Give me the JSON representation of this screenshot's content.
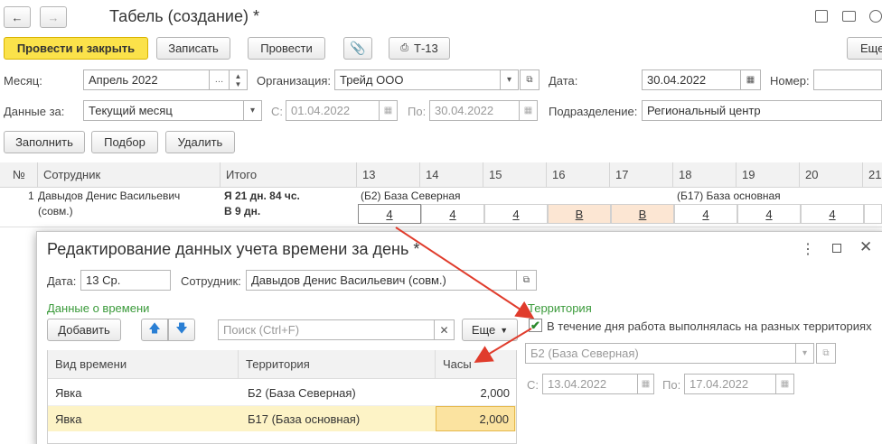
{
  "header": {
    "back_icon": "arrow-left-icon",
    "forward_icon": "arrow-right-icon",
    "title": "Табель (создание) *"
  },
  "toolbar": {
    "post_close": "Провести и закрыть",
    "save": "Записать",
    "post": "Провести",
    "t13": "Т-13",
    "more": "Еще"
  },
  "form": {
    "month_label": "Месяц:",
    "month_value": "Апрель 2022",
    "org_label": "Организация:",
    "org_value": "Трейд ООО",
    "date_label": "Дата:",
    "date_value": "30.04.2022",
    "number_label": "Номер:",
    "data_label": "Данные за:",
    "data_value": "Текущий месяц",
    "from_label": "С:",
    "from_value": "01.04.2022",
    "to_label": "По:",
    "to_value": "30.04.2022",
    "dept_label": "Подразделение:",
    "dept_value": "Региональный центр"
  },
  "actions": {
    "fill": "Заполнить",
    "select": "Подбор",
    "delete": "Удалить"
  },
  "grid": {
    "col_num": "№",
    "col_emp": "Сотрудник",
    "col_total": "Итого",
    "days": [
      "13",
      "14",
      "15",
      "16",
      "17",
      "18",
      "19",
      "20",
      "21"
    ],
    "row": {
      "num": "1",
      "employee_line1": "Давыдов Денис Васильевич",
      "employee_line2": "(совм.)",
      "total_line1": "Я 21 дн. 84 чс.",
      "total_line2": "В 9 дн.",
      "terr1": "(Б2) База Северная",
      "terr2": "(Б17) База основная",
      "values": [
        "4",
        "4",
        "4",
        "В",
        "В",
        "4",
        "4",
        "4"
      ]
    }
  },
  "dialog": {
    "title": "Редактирование данных учета времени за день *",
    "date_label": "Дата:",
    "date_value": "13 Ср.",
    "emp_label": "Сотрудник:",
    "emp_value": "Давыдов Денис Васильевич (совм.)",
    "section_time": "Данные о времени",
    "add": "Добавить",
    "search_placeholder": "Поиск (Ctrl+F)",
    "more": "Еще",
    "col_kind": "Вид времени",
    "col_terr": "Территория",
    "col_hours": "Часы",
    "rows": [
      {
        "kind": "Явка",
        "terr": "Б2 (База Северная)",
        "hours": "2,000"
      },
      {
        "kind": "Явка",
        "terr": "Б17 (База основная)",
        "hours": "2,000"
      }
    ],
    "section_terr": "Территория",
    "checkbox_label": "В течение дня работа выполнялась на разных территориях",
    "terr_value": "Б2 (База Северная)",
    "from_label": "С:",
    "from_value": "13.04.2022",
    "to_label": "По:",
    "to_value": "17.04.2022"
  },
  "colors": {
    "accent": "#fbe24a",
    "highlight_row": "#fdf3c6",
    "weekend": "#fce6d3",
    "arrow": "#e03c2c",
    "section_green": "#3a9a3a"
  }
}
